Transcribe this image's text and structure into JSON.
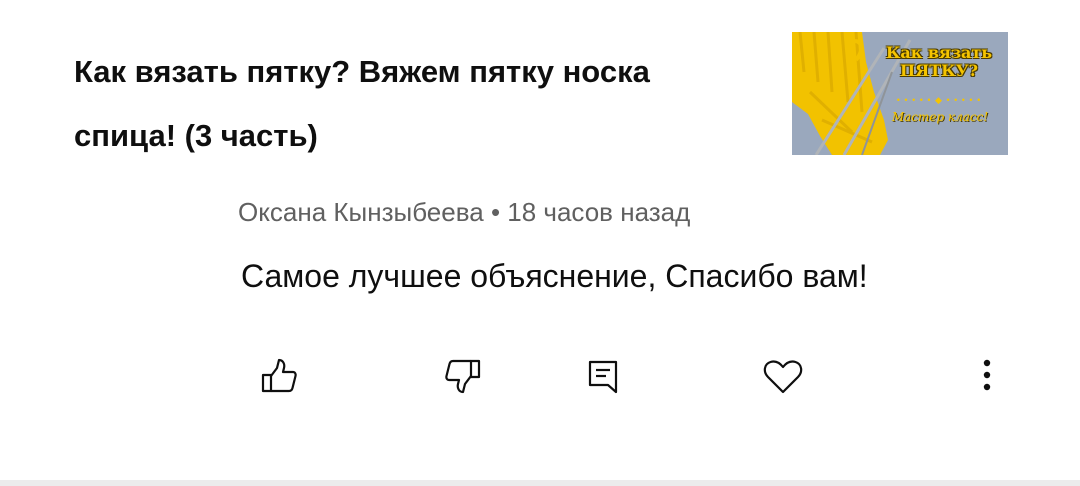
{
  "video": {
    "title": "Как вязать пятку? Вяжем пятку носка спица! (3 часть)",
    "thumbnail": {
      "title_line1": "Как вязать",
      "title_line2": "ПЯТКУ?",
      "dots": "• • • • • ◆ • • • • •",
      "subtitle": "Мастер класс!",
      "colors": {
        "background": "#9aa8bd",
        "yarn": "#f5c400",
        "needle": "#b0b4b8"
      }
    }
  },
  "comment": {
    "author": "Оксана Кынзыбеева",
    "separator": "•",
    "time": "18 часов назад",
    "text": "Самое лучшее объяснение, Спасибо вам!"
  },
  "actions": [
    {
      "name": "like-button",
      "icon": "thumbs-up-icon"
    },
    {
      "name": "dislike-button",
      "icon": "thumbs-down-icon"
    },
    {
      "name": "reply-button",
      "icon": "comment-icon"
    },
    {
      "name": "heart-button",
      "icon": "heart-icon"
    },
    {
      "name": "more-button",
      "icon": "more-vert-icon"
    }
  ]
}
